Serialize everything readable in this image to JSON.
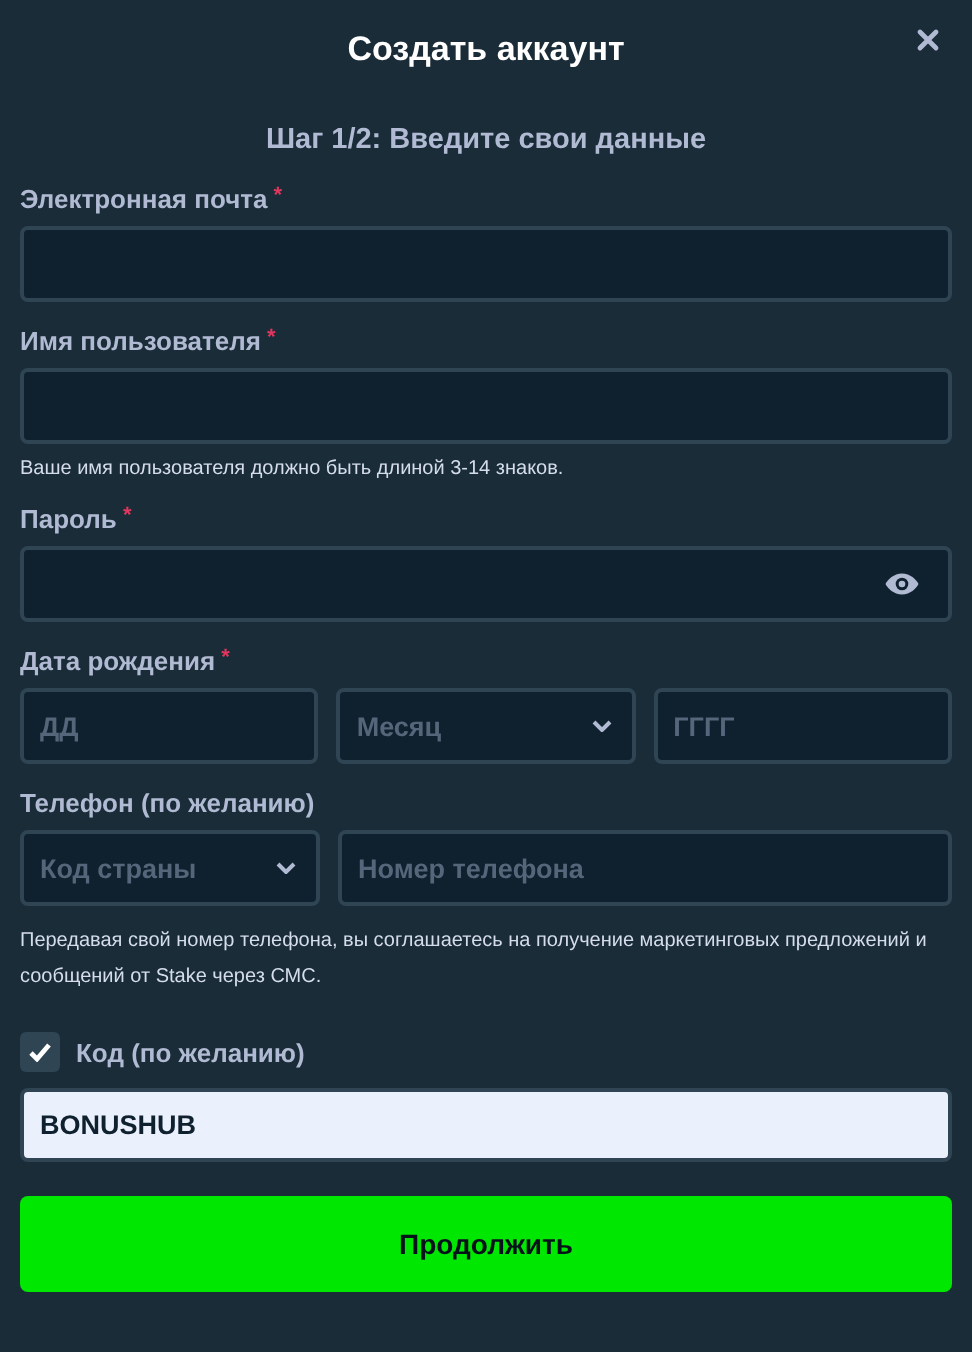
{
  "title": "Создать аккаунт",
  "step": "Шаг 1/2: Введите свои данные",
  "required_mark": "*",
  "email": {
    "label": "Электронная почта",
    "required": true
  },
  "username": {
    "label": "Имя пользователя",
    "required": true,
    "hint": "Ваше имя пользователя должно быть длиной 3-14 знаков."
  },
  "password": {
    "label": "Пароль",
    "required": true
  },
  "birth_date": {
    "label": "Дата рождения",
    "required": true,
    "day_placeholder": "ДД",
    "month_placeholder": "Месяц",
    "year_placeholder": "ГГГГ"
  },
  "phone": {
    "label": "Телефон (по желанию)",
    "required": false,
    "country_placeholder": "Код страны",
    "number_placeholder": "Номер телефона",
    "note": "Передавая свой номер телефона, вы соглашаетесь на получение маркетинговых предложений и сообщений от Stake через СМС."
  },
  "promo": {
    "label": "Код (по желанию)",
    "checked": true,
    "value": "BONUSHUB"
  },
  "submit": "Продолжить"
}
